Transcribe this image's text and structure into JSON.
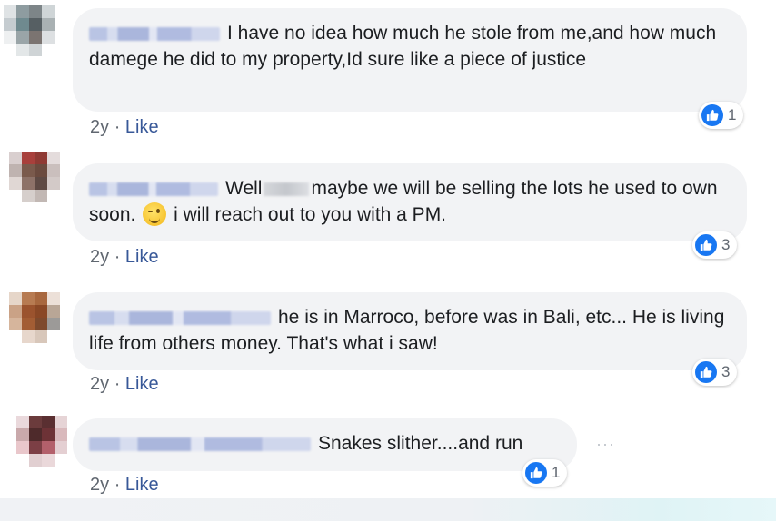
{
  "comments": [
    {
      "text": "I have no idea how much he stole from me,and how much damege he did to my property,Id sure like a piece of justice",
      "time": "2y",
      "sep": "·",
      "like_label": "Like",
      "reaction_count": "1"
    },
    {
      "text_before": "Well",
      "text_after": "maybe we will be selling the lots he used to own soon.",
      "text_end": "i will reach out to you with a PM.",
      "emoji": "wink-emoji",
      "time": "2y",
      "sep": "·",
      "like_label": "Like",
      "reaction_count": "3"
    },
    {
      "text": "he is in Marroco, before was in Bali, etc... He is living life from others money. That's what i saw!",
      "time": "2y",
      "sep": "·",
      "like_label": "Like",
      "reaction_count": "3"
    },
    {
      "text": "Snakes slither....and run",
      "time": "2y",
      "sep": "·",
      "like_label": "Like",
      "reaction_count": "1",
      "more_label": "···"
    }
  ],
  "icons": {
    "reaction": "thumbs-up-icon",
    "more": "more-options-icon"
  },
  "colors": {
    "bubble": "#f2f3f5",
    "like_link": "#385898",
    "reaction_blue": "#1877f2",
    "meta_gray": "#606770"
  }
}
